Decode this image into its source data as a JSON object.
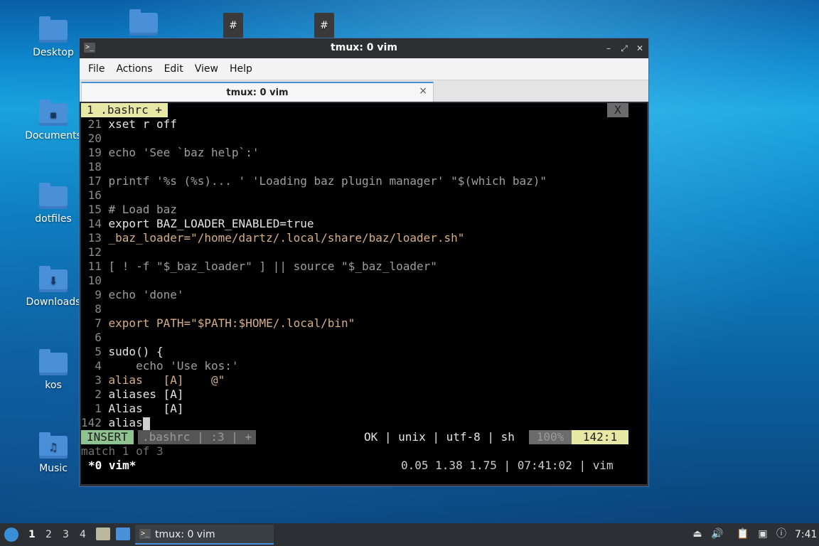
{
  "desktop": {
    "icons": [
      {
        "label": "Desktop",
        "glyph": ""
      },
      {
        "label": "Documents",
        "glyph": "▪"
      },
      {
        "label": "dotfiles",
        "glyph": ""
      },
      {
        "label": "Downloads",
        "glyph": "⬇"
      },
      {
        "label": "kos",
        "glyph": ""
      },
      {
        "label": "Music",
        "glyph": "♫"
      }
    ],
    "top_files": [
      "",
      "#",
      "#"
    ]
  },
  "window": {
    "title": "tmux: 0 vim",
    "menu": [
      "File",
      "Actions",
      "Edit",
      "View",
      "Help"
    ],
    "tab_label": "tmux: 0 vim",
    "tab_close": "×"
  },
  "vim": {
    "tab": "1 .bashrc +",
    "tab_close": "X",
    "lines": [
      {
        "n": "21",
        "text": "xset r off"
      },
      {
        "n": "20",
        "text": ""
      },
      {
        "n": "19",
        "text": "echo 'See `baz help`:'"
      },
      {
        "n": "18",
        "text": ""
      },
      {
        "n": "17",
        "text": "printf '%s (%s)... ' 'Loading baz plugin manager' \"$(which baz)\""
      },
      {
        "n": "16",
        "text": ""
      },
      {
        "n": "15",
        "text": "# Load baz"
      },
      {
        "n": "14",
        "text": "export BAZ_LOADER_ENABLED=true"
      },
      {
        "n": "13",
        "text": "_baz_loader=\"/home/dartz/.local/share/baz/loader.sh\""
      },
      {
        "n": "12",
        "text": ""
      },
      {
        "n": "11",
        "text": "[ ! -f \"$_baz_loader\" ] || source \"$_baz_loader\""
      },
      {
        "n": "10",
        "text": ""
      },
      {
        "n": "9",
        "text": "echo 'done'"
      },
      {
        "n": "8",
        "text": ""
      },
      {
        "n": "7",
        "text": "export PATH=\"$PATH:$HOME/.local/bin\""
      },
      {
        "n": "6",
        "text": ""
      },
      {
        "n": "5",
        "text": "sudo() {"
      },
      {
        "n": "4",
        "text": "    echo 'Use kos:'"
      },
      {
        "n": "3",
        "text": "alias   [A]    @\""
      },
      {
        "n": "2",
        "text": "aliases [A]"
      },
      {
        "n": "1",
        "text": "Alias   [A]"
      },
      {
        "n": "142",
        "text": "alias"
      }
    ],
    "status": {
      "mode": "INSERT",
      "file": ".bashrc | :3 | +",
      "info": "OK | unix | utf-8 | sh",
      "percent": "100%",
      "position": "142:1"
    },
    "message": "match 1 of 3"
  },
  "tmux": {
    "window": "*0 vim*",
    "right": "0.05 1.38 1.75 | 07:41:02 | vim"
  },
  "taskbar": {
    "workspaces": [
      "1",
      "2",
      "3",
      "4"
    ],
    "active_workspace": "1",
    "task_label": "tmux: 0 vim",
    "clock": "7:41"
  }
}
